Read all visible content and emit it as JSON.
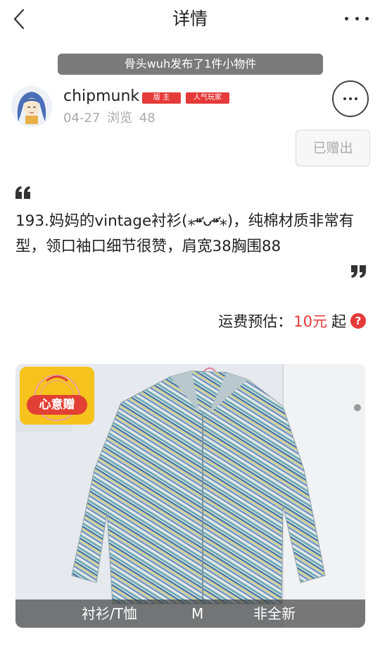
{
  "header": {
    "title": "详情"
  },
  "banner": {
    "text": "骨头wuh发布了1件小物件"
  },
  "author": {
    "name": "chipmunk",
    "badges": [
      "版 主",
      "人气玩家"
    ],
    "date": "04-27",
    "views_label": "浏览",
    "views": "48"
  },
  "actions": {
    "gifted_label": "已赠出"
  },
  "post": {
    "text": "193.妈妈的vintage衬衫(⁎⁍̴̛ᴗ⁍̴̛⁎)，纯棉材质非常有型，领口袖口细节很赞，肩宽38胸围88"
  },
  "shipping": {
    "label": "运费预估：",
    "price": "10元",
    "suffix": "起",
    "help": "?"
  },
  "photo": {
    "gift_tag": "心意赠",
    "category": "衬衫/T恤",
    "size": "M",
    "condition": "非全新"
  },
  "colors": {
    "accent_red": "#e53a3a",
    "banner_gray": "#7a7a7a",
    "tag_yellow": "#f6c21c"
  },
  "icons": {
    "back": "chevron-left-icon",
    "more": "more-horizontal-icon",
    "options": "more-circle-icon",
    "quote_open": "quote-open-icon",
    "quote_close": "quote-close-icon",
    "help": "question-circle-icon"
  }
}
